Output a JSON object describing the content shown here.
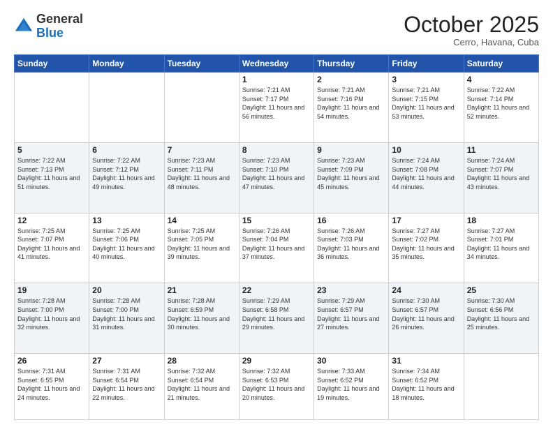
{
  "header": {
    "logo": {
      "general": "General",
      "blue": "Blue",
      "triangle_color": "#1a6fba"
    },
    "title": "October 2025",
    "subtitle": "Cerro, Havana, Cuba"
  },
  "weekdays": [
    "Sunday",
    "Monday",
    "Tuesday",
    "Wednesday",
    "Thursday",
    "Friday",
    "Saturday"
  ],
  "weeks": [
    [
      {
        "day": "",
        "info": ""
      },
      {
        "day": "",
        "info": ""
      },
      {
        "day": "",
        "info": ""
      },
      {
        "day": "1",
        "info": "Sunrise: 7:21 AM\nSunset: 7:17 PM\nDaylight: 11 hours and 56 minutes."
      },
      {
        "day": "2",
        "info": "Sunrise: 7:21 AM\nSunset: 7:16 PM\nDaylight: 11 hours and 54 minutes."
      },
      {
        "day": "3",
        "info": "Sunrise: 7:21 AM\nSunset: 7:15 PM\nDaylight: 11 hours and 53 minutes."
      },
      {
        "day": "4",
        "info": "Sunrise: 7:22 AM\nSunset: 7:14 PM\nDaylight: 11 hours and 52 minutes."
      }
    ],
    [
      {
        "day": "5",
        "info": "Sunrise: 7:22 AM\nSunset: 7:13 PM\nDaylight: 11 hours and 51 minutes."
      },
      {
        "day": "6",
        "info": "Sunrise: 7:22 AM\nSunset: 7:12 PM\nDaylight: 11 hours and 49 minutes."
      },
      {
        "day": "7",
        "info": "Sunrise: 7:23 AM\nSunset: 7:11 PM\nDaylight: 11 hours and 48 minutes."
      },
      {
        "day": "8",
        "info": "Sunrise: 7:23 AM\nSunset: 7:10 PM\nDaylight: 11 hours and 47 minutes."
      },
      {
        "day": "9",
        "info": "Sunrise: 7:23 AM\nSunset: 7:09 PM\nDaylight: 11 hours and 45 minutes."
      },
      {
        "day": "10",
        "info": "Sunrise: 7:24 AM\nSunset: 7:08 PM\nDaylight: 11 hours and 44 minutes."
      },
      {
        "day": "11",
        "info": "Sunrise: 7:24 AM\nSunset: 7:07 PM\nDaylight: 11 hours and 43 minutes."
      }
    ],
    [
      {
        "day": "12",
        "info": "Sunrise: 7:25 AM\nSunset: 7:07 PM\nDaylight: 11 hours and 41 minutes."
      },
      {
        "day": "13",
        "info": "Sunrise: 7:25 AM\nSunset: 7:06 PM\nDaylight: 11 hours and 40 minutes."
      },
      {
        "day": "14",
        "info": "Sunrise: 7:25 AM\nSunset: 7:05 PM\nDaylight: 11 hours and 39 minutes."
      },
      {
        "day": "15",
        "info": "Sunrise: 7:26 AM\nSunset: 7:04 PM\nDaylight: 11 hours and 37 minutes."
      },
      {
        "day": "16",
        "info": "Sunrise: 7:26 AM\nSunset: 7:03 PM\nDaylight: 11 hours and 36 minutes."
      },
      {
        "day": "17",
        "info": "Sunrise: 7:27 AM\nSunset: 7:02 PM\nDaylight: 11 hours and 35 minutes."
      },
      {
        "day": "18",
        "info": "Sunrise: 7:27 AM\nSunset: 7:01 PM\nDaylight: 11 hours and 34 minutes."
      }
    ],
    [
      {
        "day": "19",
        "info": "Sunrise: 7:28 AM\nSunset: 7:00 PM\nDaylight: 11 hours and 32 minutes."
      },
      {
        "day": "20",
        "info": "Sunrise: 7:28 AM\nSunset: 7:00 PM\nDaylight: 11 hours and 31 minutes."
      },
      {
        "day": "21",
        "info": "Sunrise: 7:28 AM\nSunset: 6:59 PM\nDaylight: 11 hours and 30 minutes."
      },
      {
        "day": "22",
        "info": "Sunrise: 7:29 AM\nSunset: 6:58 PM\nDaylight: 11 hours and 29 minutes."
      },
      {
        "day": "23",
        "info": "Sunrise: 7:29 AM\nSunset: 6:57 PM\nDaylight: 11 hours and 27 minutes."
      },
      {
        "day": "24",
        "info": "Sunrise: 7:30 AM\nSunset: 6:57 PM\nDaylight: 11 hours and 26 minutes."
      },
      {
        "day": "25",
        "info": "Sunrise: 7:30 AM\nSunset: 6:56 PM\nDaylight: 11 hours and 25 minutes."
      }
    ],
    [
      {
        "day": "26",
        "info": "Sunrise: 7:31 AM\nSunset: 6:55 PM\nDaylight: 11 hours and 24 minutes."
      },
      {
        "day": "27",
        "info": "Sunrise: 7:31 AM\nSunset: 6:54 PM\nDaylight: 11 hours and 22 minutes."
      },
      {
        "day": "28",
        "info": "Sunrise: 7:32 AM\nSunset: 6:54 PM\nDaylight: 11 hours and 21 minutes."
      },
      {
        "day": "29",
        "info": "Sunrise: 7:32 AM\nSunset: 6:53 PM\nDaylight: 11 hours and 20 minutes."
      },
      {
        "day": "30",
        "info": "Sunrise: 7:33 AM\nSunset: 6:52 PM\nDaylight: 11 hours and 19 minutes."
      },
      {
        "day": "31",
        "info": "Sunrise: 7:34 AM\nSunset: 6:52 PM\nDaylight: 11 hours and 18 minutes."
      },
      {
        "day": "",
        "info": ""
      }
    ]
  ]
}
